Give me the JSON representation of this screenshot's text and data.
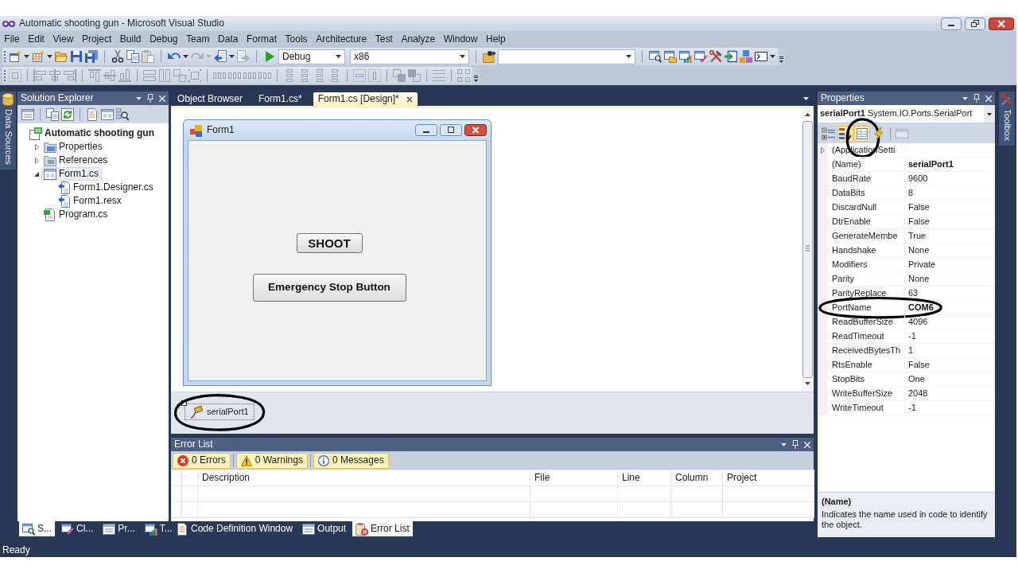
{
  "window": {
    "title": "Automatic shooting gun - Microsoft Visual Studio"
  },
  "menu": [
    "File",
    "Edit",
    "View",
    "Project",
    "Build",
    "Debug",
    "Team",
    "Data",
    "Format",
    "Tools",
    "Architecture",
    "Test",
    "Analyze",
    "Window",
    "Help"
  ],
  "standard_toolbar": {
    "configuration": "Debug",
    "platform": "x86"
  },
  "layout_toolbar": {
    "disabled": true
  },
  "left_side_tabs": [
    "Data Sources"
  ],
  "solution_explorer": {
    "title": "Solution Explorer",
    "tree": [
      {
        "label": "Automatic shooting gun",
        "kind": "project",
        "selected": false,
        "children": [
          {
            "label": "Properties",
            "kind": "properties",
            "expanded": false,
            "selected": false
          },
          {
            "label": "References",
            "kind": "references",
            "expanded": false,
            "selected": false
          },
          {
            "label": "Form1.cs",
            "kind": "form",
            "expanded": true,
            "selected": true,
            "children": [
              {
                "label": "Form1.Designer.cs",
                "kind": "dependent",
                "selected": false
              },
              {
                "label": "Form1.resx",
                "kind": "dependent",
                "selected": false
              }
            ]
          },
          {
            "label": "Program.cs",
            "kind": "code",
            "selected": false
          }
        ]
      }
    ],
    "tabs": [
      {
        "label": "S...",
        "selected": true
      },
      {
        "label": "Cl...",
        "selected": false
      },
      {
        "label": "Pr...",
        "selected": false
      },
      {
        "label": "T...",
        "selected": false
      }
    ]
  },
  "documents": {
    "tabs": [
      {
        "label": "Object Browser",
        "selected": false
      },
      {
        "label": "Form1.cs*",
        "selected": false
      },
      {
        "label": "Form1.cs [Design]*",
        "selected": true
      }
    ],
    "designer": {
      "form": {
        "title": "Form1",
        "buttons": [
          "SHOOT",
          "Emergency Stop Button"
        ]
      },
      "components": [
        {
          "label": "serialPort1",
          "selected": true,
          "circled": true
        }
      ]
    }
  },
  "error_list": {
    "title": "Error List",
    "filters": [
      {
        "kind": "error",
        "label": "0 Errors",
        "on": true
      },
      {
        "kind": "warning",
        "label": "0 Warnings",
        "on": true
      },
      {
        "kind": "message",
        "label": "0 Messages",
        "on": true
      }
    ],
    "columns": [
      "Description",
      "File",
      "Line",
      "Column",
      "Project"
    ]
  },
  "bottom_tabs": [
    {
      "label": "Code Definition Window",
      "selected": false
    },
    {
      "label": "Output",
      "selected": false
    },
    {
      "label": "Error List",
      "selected": true
    }
  ],
  "properties": {
    "title": "Properties",
    "object": "**serialPort1** System.IO.Ports.SerialPort",
    "toolbar": [
      {
        "selected": false,
        "disabled": false,
        "circled": false
      },
      {
        "selected": true,
        "disabled": false,
        "circled": false
      },
      {
        "selected": true,
        "disabled": false,
        "circled": true
      },
      {
        "selected": false,
        "disabled": false,
        "circled": false
      },
      {
        "selected": false,
        "disabled": true,
        "circled": false
      }
    ],
    "rows": [
      {
        "kind": "group",
        "name": "(ApplicationSetti",
        "expanded": false,
        "circled": false
      },
      {
        "kind": "property",
        "name": "(Name)",
        "value": "serialPort1",
        "modified": true,
        "circled": false
      },
      {
        "kind": "property",
        "name": "BaudRate",
        "value": "9600",
        "modified": false,
        "circled": false
      },
      {
        "kind": "property",
        "name": "DataBits",
        "value": "8",
        "modified": false,
        "circled": false
      },
      {
        "kind": "property",
        "name": "DiscardNull",
        "value": "False",
        "modified": false,
        "circled": false
      },
      {
        "kind": "property",
        "name": "DtrEnable",
        "value": "False",
        "modified": false,
        "circled": false
      },
      {
        "kind": "property",
        "name": "GenerateMembe",
        "value": "True",
        "modified": false,
        "circled": false
      },
      {
        "kind": "property",
        "name": "Handshake",
        "value": "None",
        "modified": false,
        "circled": false
      },
      {
        "kind": "property",
        "name": "Modifiers",
        "value": "Private",
        "modified": false,
        "circled": false
      },
      {
        "kind": "property",
        "name": "Parity",
        "value": "None",
        "modified": false,
        "circled": false
      },
      {
        "kind": "property",
        "name": "ParityReplace",
        "value": "63",
        "modified": false,
        "circled": false
      },
      {
        "kind": "property",
        "name": "PortName",
        "value": "COM6",
        "modified": true,
        "circled": true
      },
      {
        "kind": "property",
        "name": "ReadBufferSize",
        "value": "4096",
        "modified": false,
        "circled": false
      },
      {
        "kind": "property",
        "name": "ReadTimeout",
        "value": "-1",
        "modified": false,
        "circled": false
      },
      {
        "kind": "property",
        "name": "ReceivedBytesTh",
        "value": "1",
        "modified": false,
        "circled": false
      },
      {
        "kind": "property",
        "name": "RtsEnable",
        "value": "False",
        "modified": false,
        "circled": false
      },
      {
        "kind": "property",
        "name": "StopBits",
        "value": "One",
        "modified": false,
        "circled": false
      },
      {
        "kind": "property",
        "name": "WriteBufferSize",
        "value": "2048",
        "modified": false,
        "circled": false
      },
      {
        "kind": "property",
        "name": "WriteTimeout",
        "value": "-1",
        "modified": false,
        "circled": false
      }
    ],
    "description": {
      "title": "(Name)",
      "text": "Indicates the name used in code to identify the object."
    }
  },
  "right_side_tabs": [
    "Toolbox"
  ],
  "status_bar": {
    "text": "Ready"
  }
}
